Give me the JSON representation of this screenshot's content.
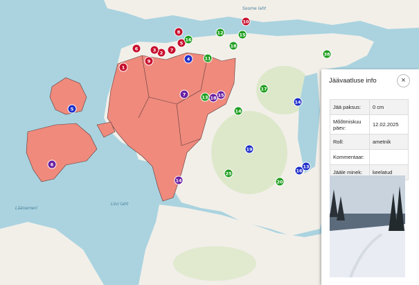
{
  "colors": {
    "sea": "#aad3df",
    "land": "#f2efe9",
    "highlight_region": "#ef8a7c",
    "forest": "#cfe3b6",
    "marker_red": "#c8102e",
    "marker_green": "#1f9e1f",
    "marker_blue": "#1f2fc9",
    "marker_purple": "#6a1fa0"
  },
  "map": {
    "sea_labels": [
      "Läänemeri",
      "Liivi laht",
      "Soome laht"
    ],
    "markers": [
      {
        "label": "1",
        "color": "red"
      },
      {
        "label": "6",
        "color": "red"
      },
      {
        "label": "8",
        "color": "red"
      },
      {
        "label": "5",
        "color": "red"
      },
      {
        "label": "7",
        "color": "red"
      },
      {
        "label": "2",
        "color": "red"
      },
      {
        "label": "3",
        "color": "red"
      },
      {
        "label": "9",
        "color": "red"
      },
      {
        "label": "10",
        "color": "red"
      },
      {
        "label": "12",
        "color": "green"
      },
      {
        "label": "11",
        "color": "green"
      },
      {
        "label": "16",
        "color": "green"
      },
      {
        "label": "15",
        "color": "green"
      },
      {
        "label": "17",
        "color": "green"
      },
      {
        "label": "18",
        "color": "green"
      },
      {
        "label": "13",
        "color": "green"
      },
      {
        "label": "14",
        "color": "green"
      },
      {
        "label": "25",
        "color": "green"
      },
      {
        "label": "38",
        "color": "green"
      },
      {
        "label": "19",
        "color": "blue"
      },
      {
        "label": "20",
        "color": "green"
      },
      {
        "label": "4",
        "color": "blue"
      },
      {
        "label": "14",
        "color": "blue"
      },
      {
        "label": "16",
        "color": "blue"
      },
      {
        "label": "13",
        "color": "blue"
      },
      {
        "label": "5",
        "color": "blue"
      },
      {
        "label": "7",
        "color": "purple"
      },
      {
        "label": "15",
        "color": "purple"
      },
      {
        "label": "18",
        "color": "purple"
      },
      {
        "label": "14",
        "color": "purple"
      },
      {
        "label": "6",
        "color": "purple"
      }
    ]
  },
  "panel": {
    "title": "Jäävaatluse info",
    "close_label": "×",
    "rows": [
      {
        "key": "Jää paksus:",
        "value": "0 cm"
      },
      {
        "key": "Mõõtmiskuu päev:",
        "value": "12.02.2025"
      },
      {
        "key": "Roll:",
        "value": "ametnik"
      },
      {
        "key": "Kommentaar:",
        "value": ""
      },
      {
        "key": "Jääle minek:",
        "value": "keelatud"
      }
    ]
  }
}
